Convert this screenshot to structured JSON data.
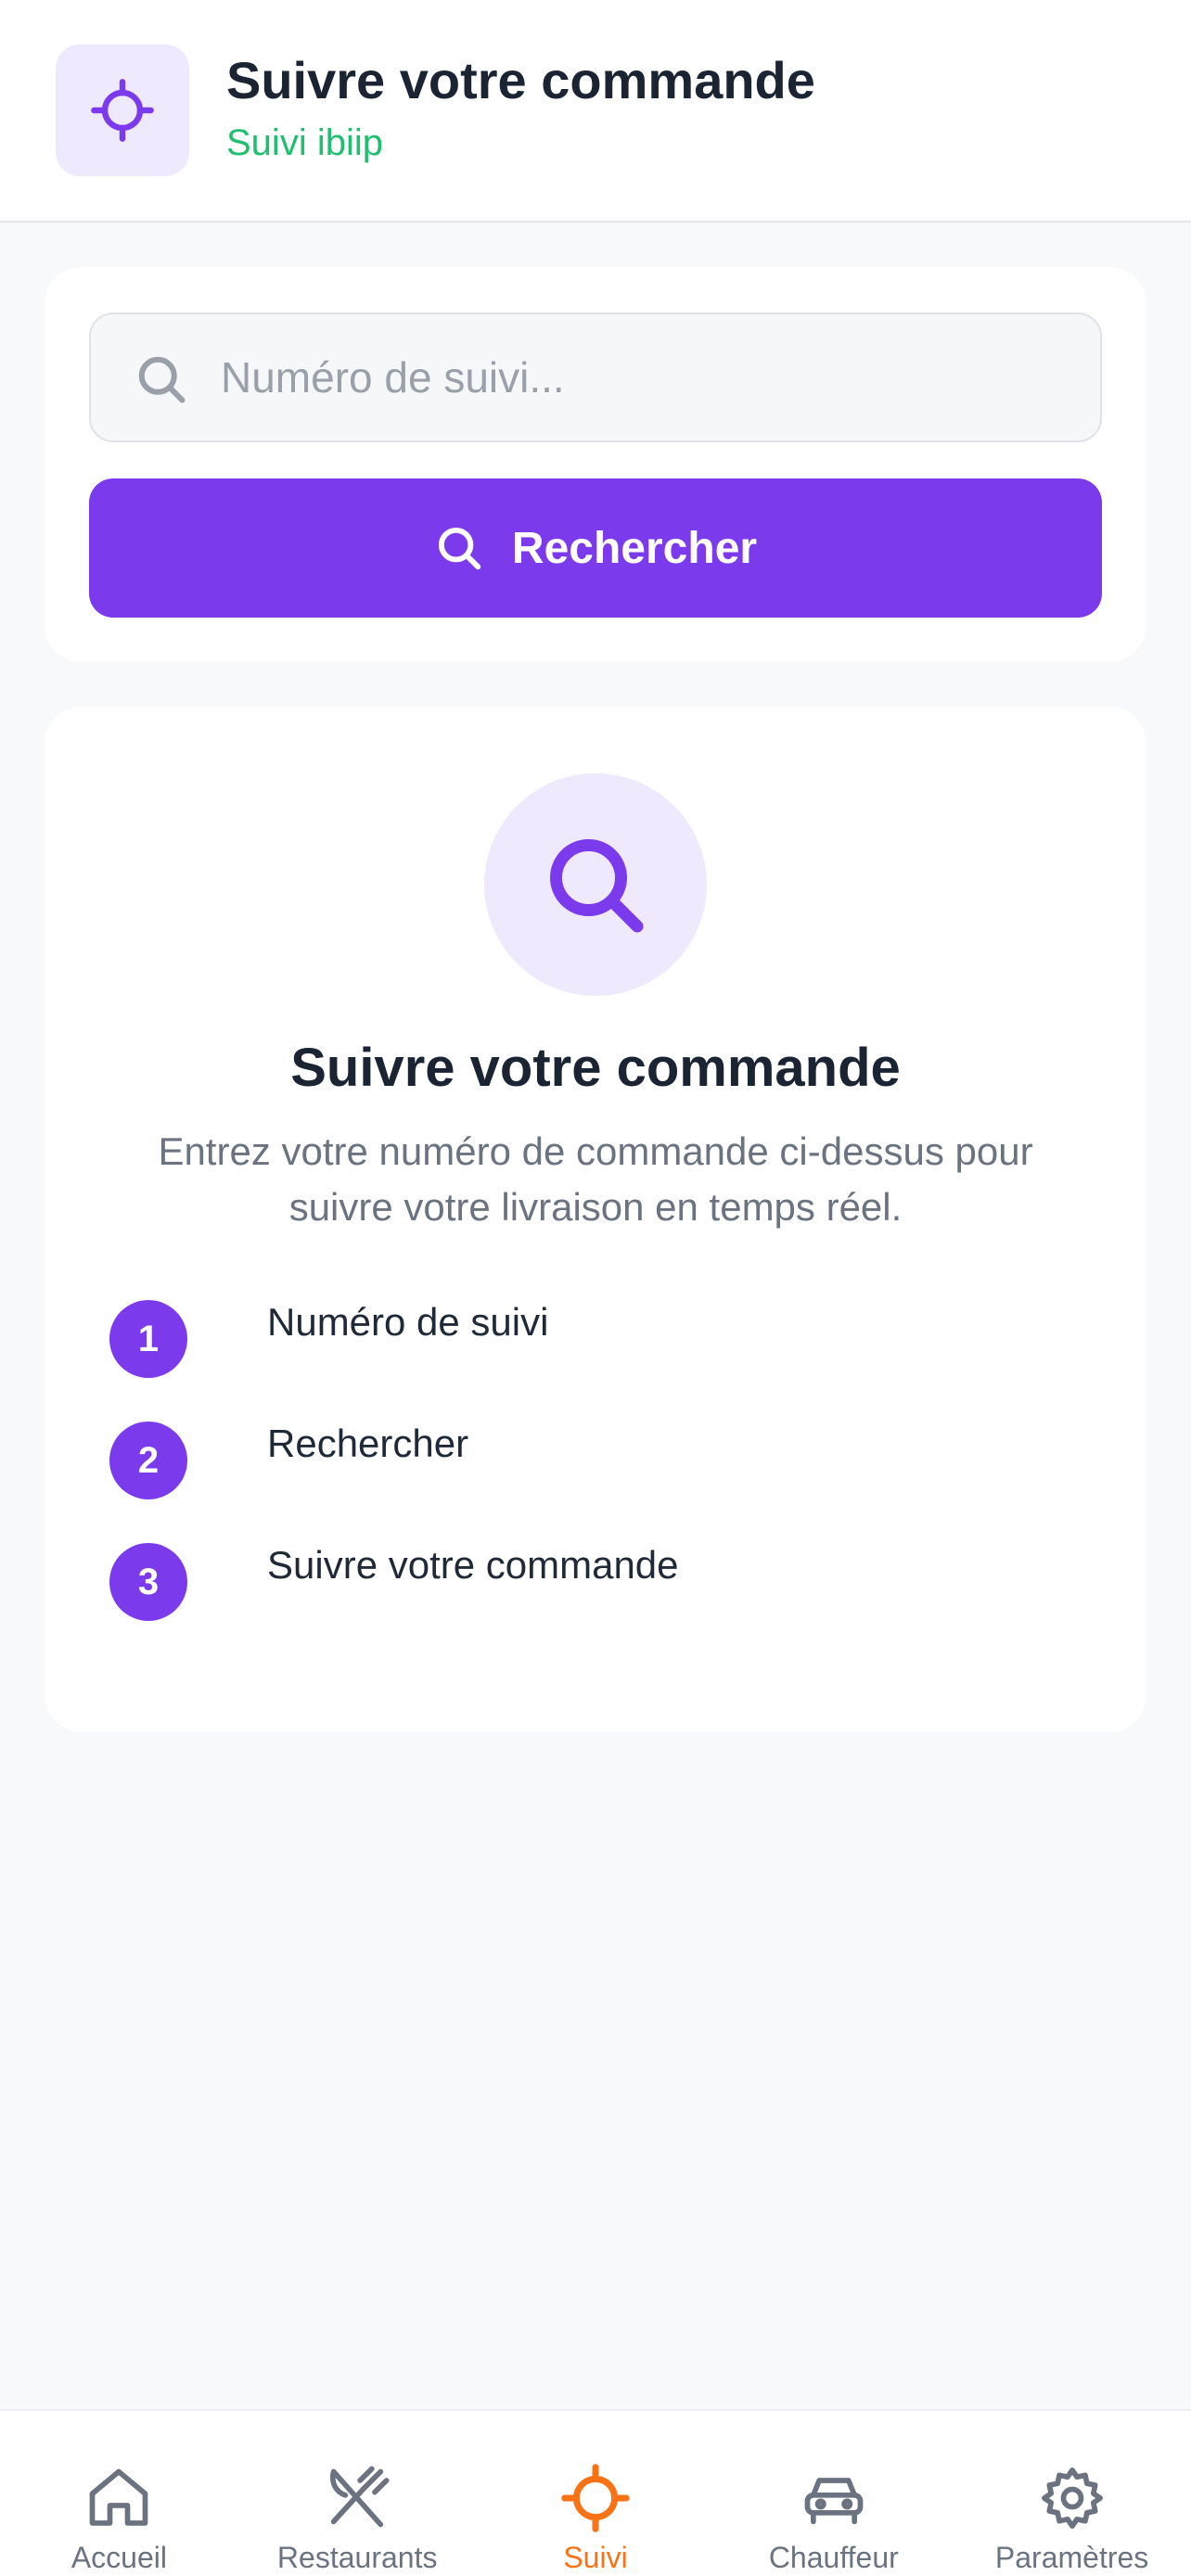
{
  "header": {
    "icon": "crosshair-icon",
    "title": "Suivre votre commande",
    "subtitle": "Suivi ibiip"
  },
  "search": {
    "placeholder": "Numéro de suivi...",
    "value": "",
    "button_label": "Rechercher"
  },
  "info": {
    "icon": "search-icon",
    "title": "Suivre votre commande",
    "description": "Entrez votre numéro de commande ci-dessus pour suivre votre livraison en temps réel.",
    "steps": [
      {
        "number": "1",
        "label": "Numéro de suivi"
      },
      {
        "number": "2",
        "label": "Rechercher"
      },
      {
        "number": "3",
        "label": "Suivre votre commande"
      }
    ]
  },
  "nav": {
    "items": [
      {
        "label": "Accueil",
        "icon": "home-icon",
        "active": false
      },
      {
        "label": "Restaurants",
        "icon": "utensils-icon",
        "active": false
      },
      {
        "label": "Suivi",
        "icon": "crosshair-icon",
        "active": true
      },
      {
        "label": "Chauffeur",
        "icon": "car-icon",
        "active": false
      },
      {
        "label": "Paramètres",
        "icon": "gear-icon",
        "active": false
      }
    ]
  },
  "colors": {
    "accent": "#7c3aed",
    "accent_light": "#efe9fd",
    "active_nav": "#f97316",
    "subtitle_green": "#1fbf6f",
    "background": "#f8f9fb"
  }
}
